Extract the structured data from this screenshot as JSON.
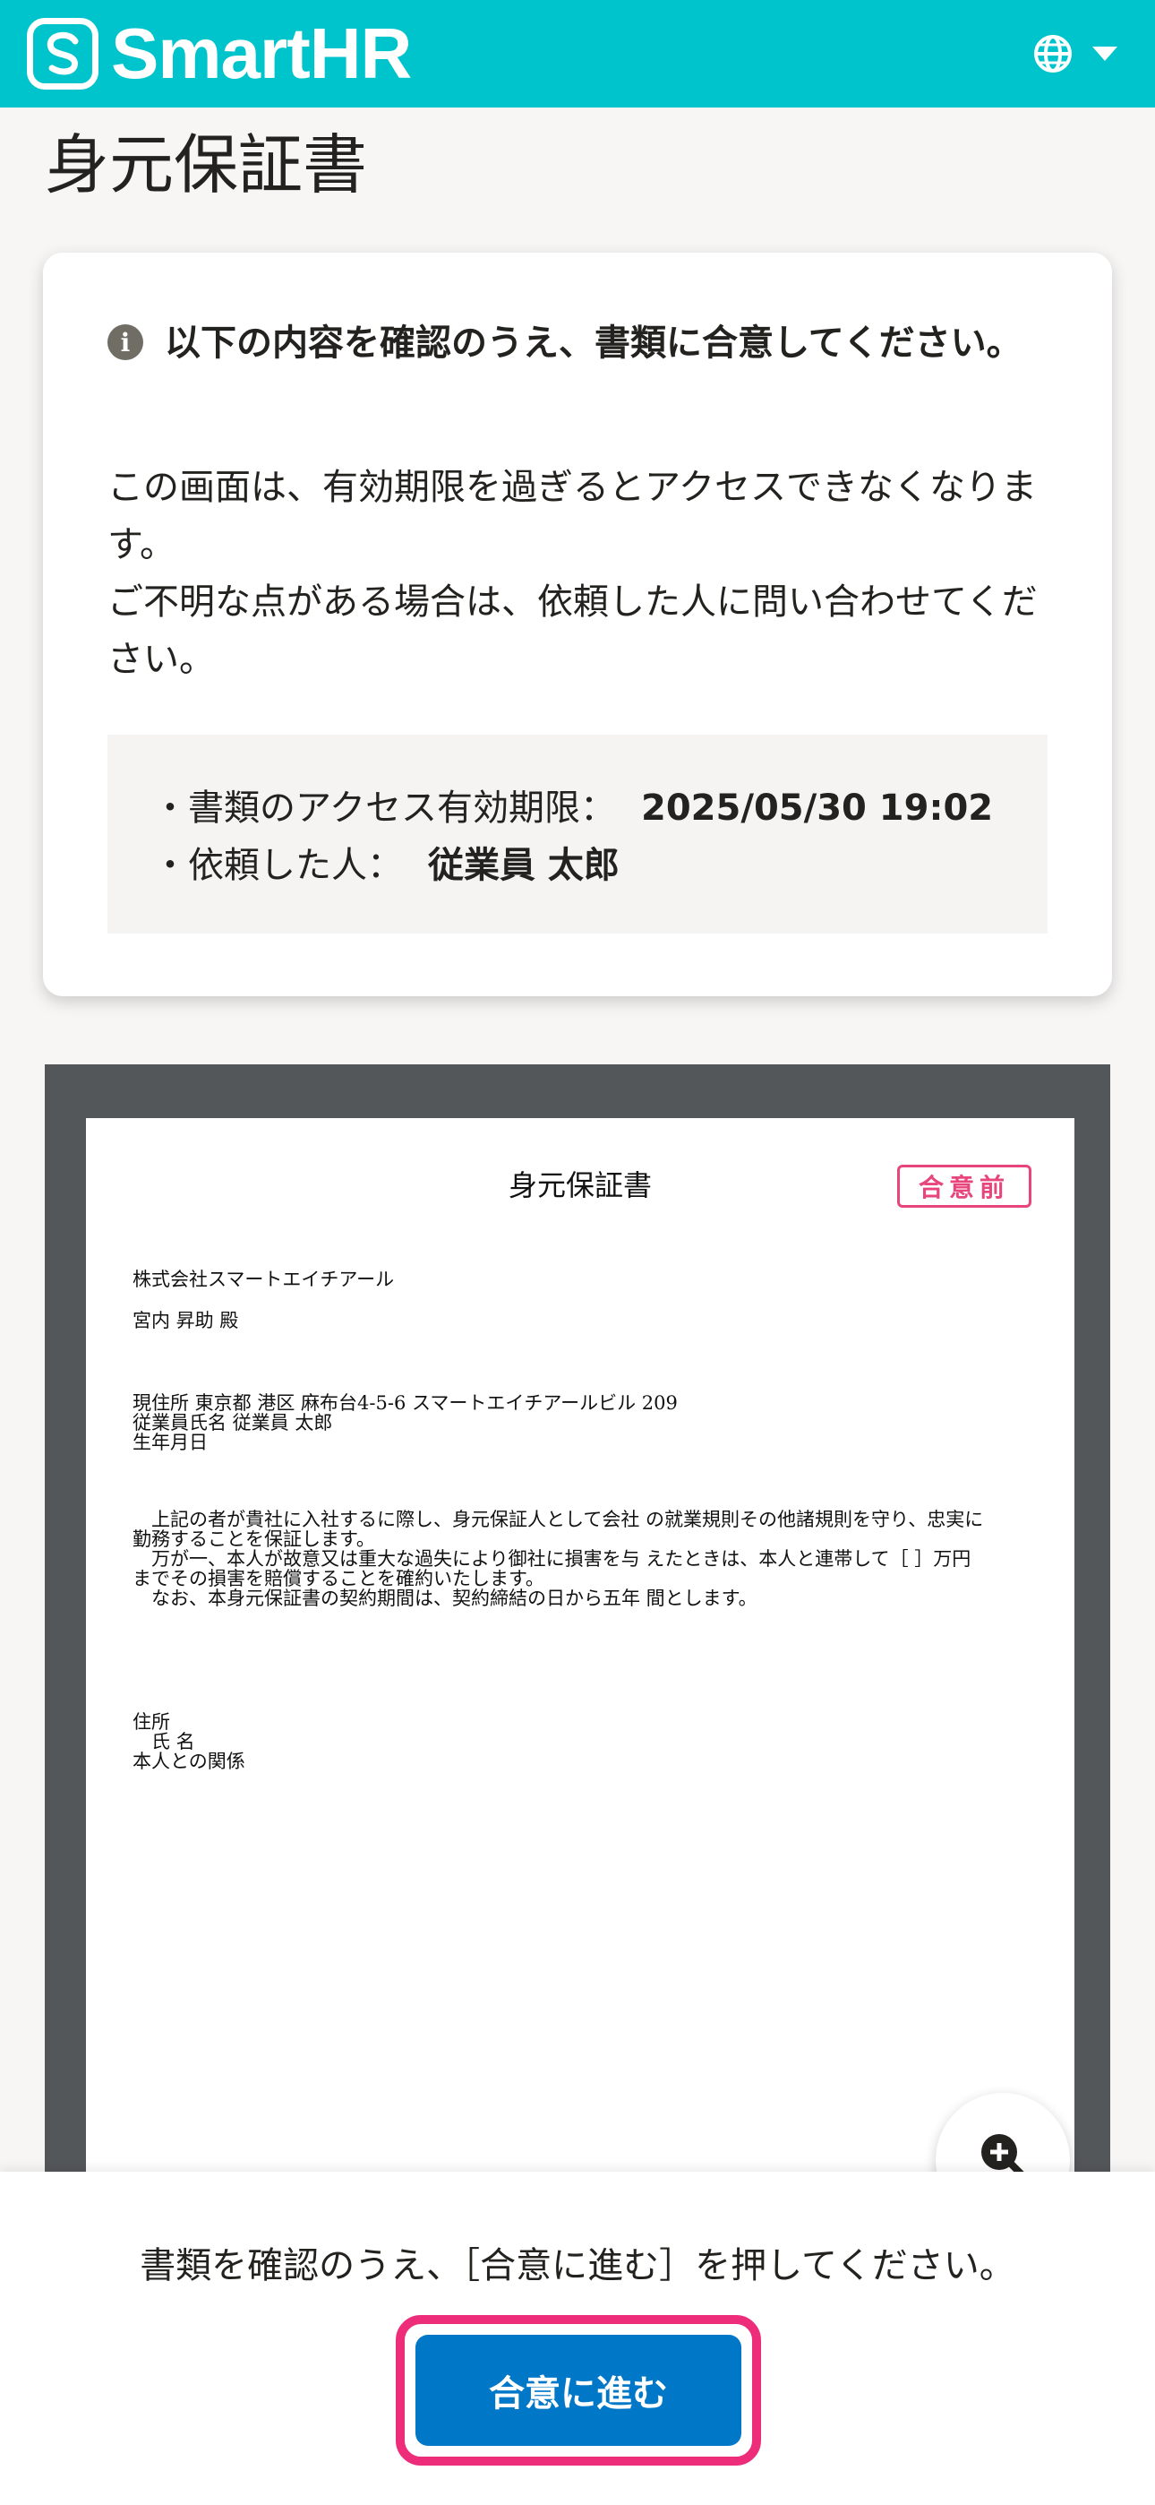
{
  "header": {
    "brand_name": "SmartHR",
    "brand_color": "#00c4cc",
    "logo_icon": "smarthr-s-logo-icon",
    "language_icon": "globe-icon",
    "dropdown_icon": "caret-down-icon"
  },
  "page": {
    "title": "身元保証書"
  },
  "info_card": {
    "notice_icon": "info-icon",
    "notice": "以下の内容を確認のうえ、書類に合意してください。",
    "description_line1": "この画面は、有効期限を過ぎるとアクセスできなくなります。",
    "description_line2": "ご不明な点がある場合は、依頼した人に問い合わせてください。",
    "expiry_label": "・書類のアクセス有効期限：",
    "expiry_value": "2025/05/30 19:02",
    "requester_label": "・依頼した人：",
    "requester_value": "従業員 太郎"
  },
  "document": {
    "title": "身元保証書",
    "status_stamp": "合意前",
    "stamp_color": "#e8457c",
    "company": "株式会社スマートエイチアール",
    "addressee": "宮内 昇助 殿",
    "address_line": "現住所 東京都 港区 麻布台4-5-6 スマートエイチアールビル 209",
    "employee_line": "従業員氏名 従業員 太郎",
    "birth_line": "生年月日",
    "body_line1": "　上記の者が貴社に入社するに際し、身元保証人として会社 の就業規則その他諸規則を守り、忠実に",
    "body_line2": "勤務することを保証します。",
    "body_line3": "　万が一、本人が故意又は重大な過失により御社に損害を与 えたときは、本人と連帯して［ ］万円",
    "body_line4": "までその損害を賠償することを確約いたします。",
    "body_line5": "　なお、本身元保証書の契約期間は、契約締結の日から五年 間とします。",
    "sign_address": "住所",
    "sign_name": "　氏 名",
    "sign_relation": "本人との関係",
    "zoom_icon": "zoom-in-icon"
  },
  "action_bar": {
    "instruction": "書類を確認のうえ、［合意に進む］を押してください。",
    "agree_button": "合意に進む",
    "button_color": "#0077c7",
    "highlight_color": "#ee2d7a"
  }
}
